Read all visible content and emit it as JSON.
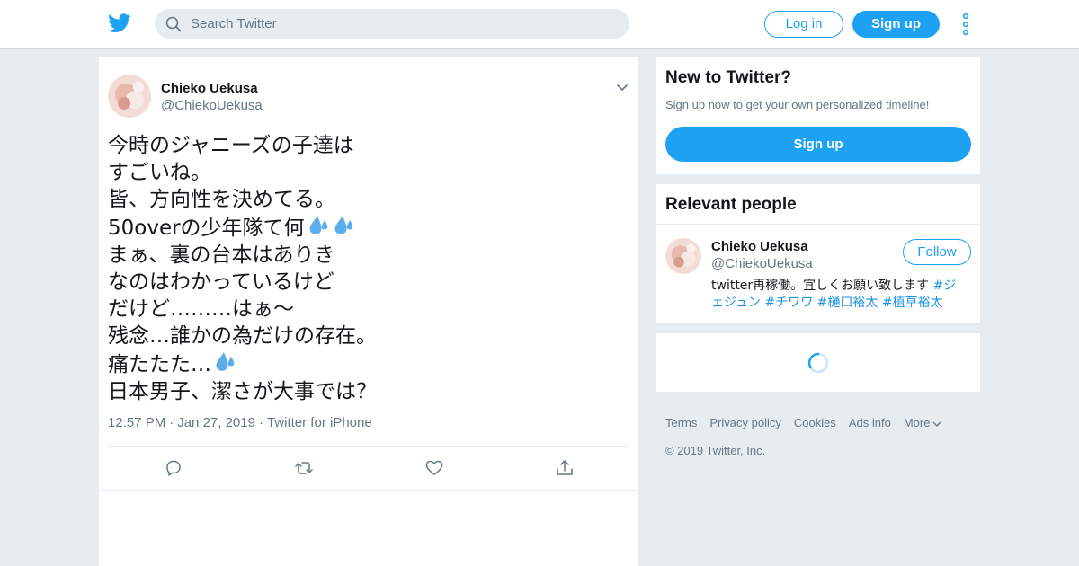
{
  "header": {
    "search_placeholder": "Search Twitter",
    "login_label": "Log in",
    "signup_label": "Sign up",
    "brand_color": "#1da1f2"
  },
  "tweet": {
    "author_name": "Chieko Uekusa",
    "author_handle": "@ChiekoUekusa",
    "lines": [
      "今時のジャニーズの子達は",
      "すごいね。",
      "皆、方向性を決めてる。",
      "50overの少年隊て何",
      "まぁ、裏の台本はありき",
      "なのはわかっているけど",
      "だけど………はぁ〜",
      "残念…誰かの為だけの存在。",
      "痛たたた…",
      "日本男子、潔さが大事では？"
    ],
    "emoji_line_4": "sweat-droplets-x2",
    "emoji_line_9": "sweat-droplets-x1",
    "time": "12:57 PM",
    "date": "Jan 27, 2019",
    "source": "Twitter for iPhone",
    "separator": "·"
  },
  "sidebar": {
    "new_title": "New to Twitter?",
    "new_desc": "Sign up now to get your own personalized timeline!",
    "new_signup": "Sign up",
    "relevant_title": "Relevant people",
    "person_name": "Chieko Uekusa",
    "person_handle": "@ChiekoUekusa",
    "follow_label": "Follow",
    "bio_text": "twitter再稼働。宜しくお願い致します ",
    "bio_tags": [
      "#ジェジュン",
      "#チワワ",
      "#樋口裕太",
      "#植草裕太"
    ]
  },
  "footer": {
    "links": [
      "Terms",
      "Privacy policy",
      "Cookies",
      "Ads info",
      "More"
    ],
    "copyright": "© 2019 Twitter, Inc."
  }
}
